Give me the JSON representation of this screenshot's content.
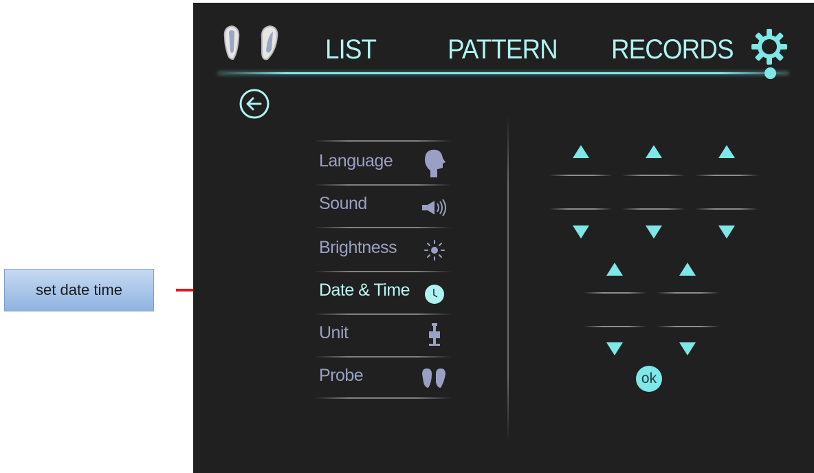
{
  "annotation": {
    "label": "set date time",
    "pointer_color": "#e5141a"
  },
  "nav": {
    "items": [
      "LIST",
      "PATTERN",
      "RECORDS"
    ]
  },
  "icons": {
    "logo": "probe-pair-icon",
    "settings": "gear-icon",
    "back": "back-arrow-icon",
    "language": "head-profile-icon",
    "sound": "speaker-icon",
    "brightness": "sun-icon",
    "date_time": "clock-icon",
    "unit": "device-cart-icon",
    "probe": "probe-pair-icon"
  },
  "settings_menu": {
    "active": "Date & Time",
    "items": [
      "Language",
      "Sound",
      "Brightness",
      "Date & Time",
      "Unit",
      "Probe"
    ]
  },
  "date_time": {
    "date_fields": [
      "",
      "",
      ""
    ],
    "time_fields": [
      "",
      ""
    ],
    "ok_label": "ok"
  },
  "colors": {
    "accent": "#7ee7e8",
    "screen_bg": "#202020",
    "menu_text": "#9aa0c4",
    "callout_fill": "#a9c6ea"
  }
}
